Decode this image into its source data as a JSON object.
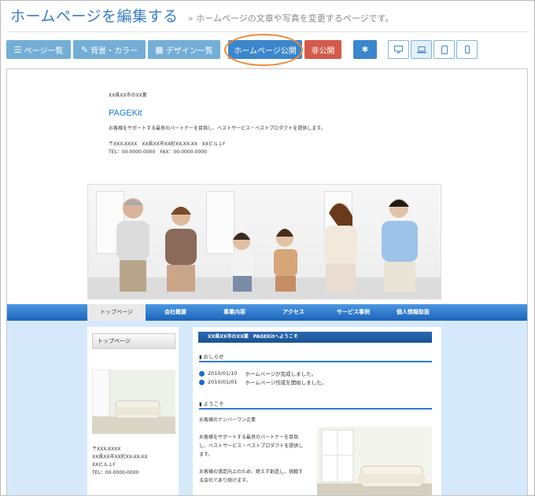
{
  "header": {
    "title": "ホームページを編集する",
    "chevron": "»",
    "subtitle": "ホームページの文章や写真を変更するページです。"
  },
  "toolbar": {
    "page_list": {
      "icon": "list-icon",
      "label": "ページ一覧"
    },
    "background_color": {
      "icon": "brush-icon",
      "label": "背景・カラー"
    },
    "design_list": {
      "icon": "grid-icon",
      "label": "デザイン一覧"
    },
    "publish": {
      "label": "ホームページ公開"
    },
    "unpublish": {
      "label": "非公開"
    },
    "settings": {
      "icon": "gear-icon"
    },
    "devices": [
      "desktop-icon",
      "laptop-icon",
      "tablet-icon",
      "phone-icon"
    ],
    "active_device": "laptop-icon"
  },
  "preview": {
    "site_header": {
      "prefecture": "XX県XX市のXX業",
      "logo": "PAGEKit",
      "tagline": "お客様をサポートする最良のパートナーを目指し、ベストサービス・ベストプロダクトを提供します。",
      "address": "〒XXX-XXXX　XX県XX市XX町XX-XX-XX　XXビル１F",
      "tel_fax": "TEL：00-0000-0000　FAX：00-0000-0000"
    },
    "nav": [
      "トップページ",
      "会社概要",
      "事業内容",
      "アクセス",
      "サービス事例",
      "個人情報取扱"
    ],
    "sidebar": {
      "tab": "トップページ",
      "address_lines": [
        "〒XXX-XXXX",
        "XX県XX市XX町XX-XX-XX",
        "XXビル１F",
        "TEL：00-0000-0000"
      ]
    },
    "main": {
      "title_bar": "XX県XX市のXX業　PAGEKitへようこそ",
      "news_heading": "おしらせ",
      "news": [
        {
          "date": "2010/01/10",
          "text": "ホームページが完成しました。"
        },
        {
          "date": "2010/01/01",
          "text": "ホームページ作成を開始しました。"
        }
      ],
      "welcome_heading": "ようこそ",
      "welcome_lines": [
        "お客様のナンバーワン企業",
        "",
        "お客様をサポートする最良のパートナーを目指",
        "し、ベストサービス・ベストプロダクトを提供し",
        "ます。",
        "",
        "お客様の満足向上のため、絶えず創造し、挑戦す",
        "る会社であり続けます。"
      ]
    }
  },
  "colors": {
    "title_blue": "#3a7dc2",
    "button_blue": "#74aed6",
    "publish_blue": "#3c86cc",
    "unpublish_red": "#d35a4a",
    "highlight_orange": "#ef8a3a"
  }
}
